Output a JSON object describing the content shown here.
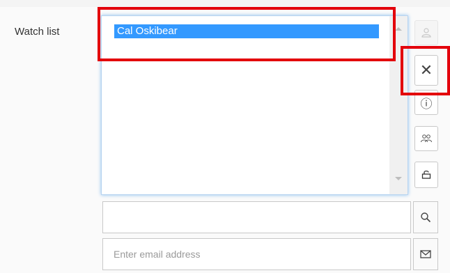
{
  "watch_list": {
    "label": "Watch list",
    "items": [
      "Cal Oskibear"
    ]
  },
  "side_buttons": {
    "add_user_icon": "add-user-icon",
    "remove_icon": "close-icon",
    "remove_glyph": "✕",
    "info_icon": "info-icon",
    "info_glyph": "ⓘ",
    "group_icon": "group-icon",
    "lock_icon": "unlock-icon"
  },
  "search": {
    "value": "",
    "icon": "search-icon"
  },
  "email": {
    "placeholder": "Enter email address",
    "icon": "mail-icon"
  },
  "colors": {
    "selection": "#3399ff",
    "highlight_box": "#e3000b"
  }
}
